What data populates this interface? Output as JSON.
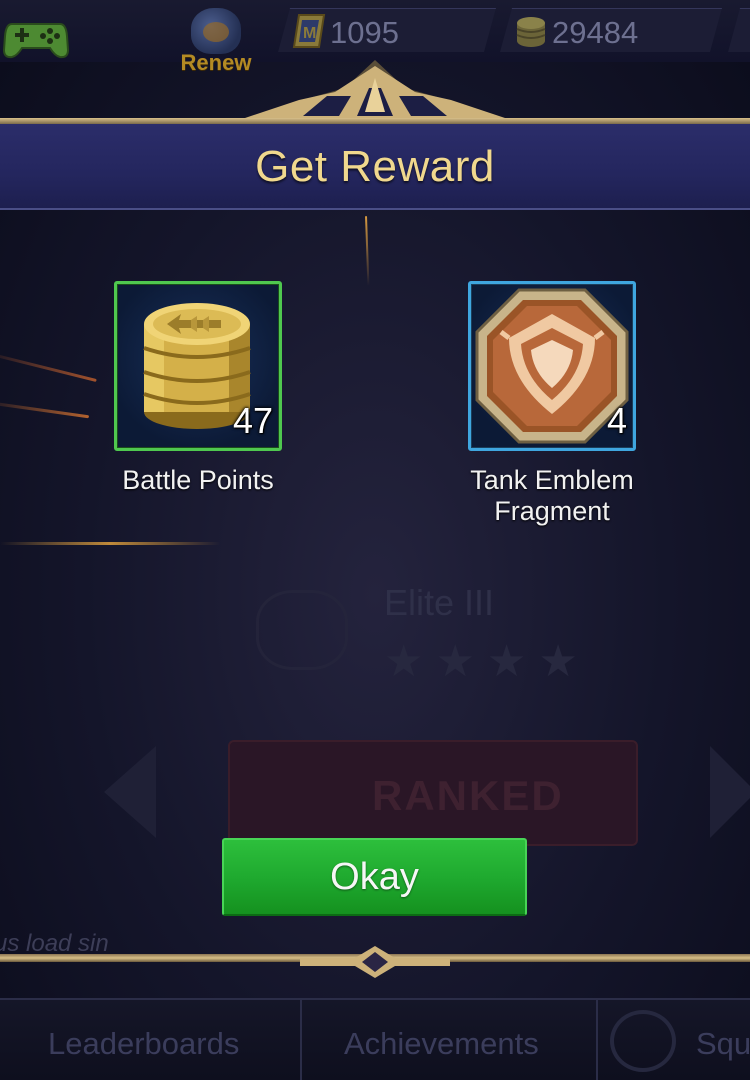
{
  "top_bar": {
    "renew_label": "Renew",
    "diamonds": "1095",
    "battle_points": "29484"
  },
  "background": {
    "rank_name": "Elite III",
    "rank_stars": 4,
    "mode_button": "RANKED",
    "hint_text": "us load sin"
  },
  "bottom_nav": {
    "items": [
      {
        "label": "Leaderboards"
      },
      {
        "label": "Achievements"
      },
      {
        "label": "Squ"
      }
    ]
  },
  "modal": {
    "title": "Get Reward",
    "rewards": [
      {
        "name": "Battle Points",
        "quantity": "47",
        "icon": "battle-points-coins-icon",
        "frame_color": "#4fc84f"
      },
      {
        "name_line1": "Tank Emblem",
        "name_line2": "Fragment",
        "quantity": "4",
        "icon": "tank-emblem-fragment-icon",
        "frame_color": "#3fa6df"
      }
    ],
    "okay_label": "Okay"
  },
  "colors": {
    "title_gold": "#f0d88e",
    "okay_green": "#1ea82e",
    "header_purple": "#2b2d6a"
  }
}
